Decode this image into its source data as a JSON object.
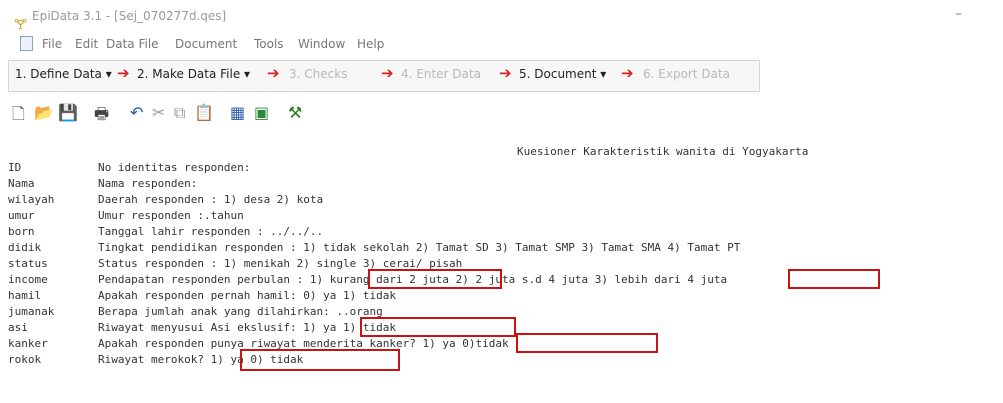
{
  "window": {
    "title": "EpiData 3.1 - [Sej_070277d.qes]",
    "app_icon": "epidata-app-icon"
  },
  "menu": {
    "items": [
      "File",
      "Edit",
      "Data File",
      "Document",
      "Tools",
      "Window",
      "Help"
    ]
  },
  "workflow": {
    "items": [
      {
        "label": "1. Define Data ▾",
        "enabled": true
      },
      {
        "label": "2. Make Data File ▾",
        "enabled": true
      },
      {
        "label": "3. Checks",
        "enabled": false
      },
      {
        "label": "4. Enter Data",
        "enabled": false
      },
      {
        "label": "5. Document ▾",
        "enabled": true
      },
      {
        "label": "6. Export Data",
        "enabled": false
      }
    ]
  },
  "toolbar": {
    "icons": [
      "new-file-icon",
      "open-folder-icon",
      "save-icon",
      "print-icon",
      "undo-icon",
      "cut-icon",
      "copy-icon",
      "paste-icon",
      "grid-icon",
      "preview-icon",
      "tool-icon"
    ]
  },
  "editor": {
    "heading": "Kuesioner Karakteristik wanita di Yogyakarta",
    "lines": [
      {
        "var": "ID",
        "label": "No identitas responden:"
      },
      {
        "var": "Nama",
        "label": "Nama responden:"
      },
      {
        "var": "wilayah",
        "label": "Daerah responden : 1) desa    2) kota"
      },
      {
        "var": "umur",
        "label": "Umur responden :.tahun"
      },
      {
        "var": "born",
        "label": "Tanggal lahir responden : ../../.."
      },
      {
        "var": "didik",
        "label": "Tingkat pendidikan responden : 1) tidak sekolah   2) Tamat SD   3) Tamat SMP   3) Tamat SMA   4) Tamat PT"
      },
      {
        "var": "status",
        "label": "Status responden :  1) menikah    2) single   3) cerai/ pisah"
      },
      {
        "var": "income",
        "label": "Pendapatan responden perbulan : 1) kurang dari 2 juta   2) 2 juta s.d 4 juta   3) lebih dari  4 juta"
      },
      {
        "var": "hamil",
        "label": "Apakah responden pernah hamil:  0) ya    1) tidak"
      },
      {
        "var": "jumanak",
        "label": "Berapa jumlah anak yang dilahirkan: ..orang"
      },
      {
        "var": "asi",
        "label": "Riwayat menyusui Asi ekslusif: 1) ya    1) tidak"
      },
      {
        "var": "kanker",
        "label": "Apakah responden punya riwayat menderita kanker?  1) ya    0)tidak"
      },
      {
        "var": "rokok",
        "label": "Riwayat merokok?  1) ya   0) tidak"
      }
    ]
  },
  "colors": {
    "highlight": "#cc1111",
    "workflow_arrow": "#dd2222"
  }
}
